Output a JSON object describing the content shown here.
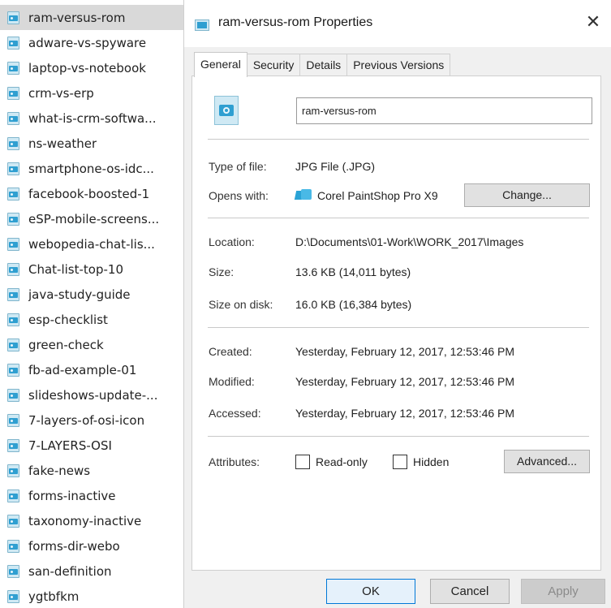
{
  "file_list": {
    "items": [
      {
        "name": "ram-versus-rom",
        "selected": true
      },
      {
        "name": "adware-vs-spyware"
      },
      {
        "name": "laptop-vs-notebook"
      },
      {
        "name": "crm-vs-erp"
      },
      {
        "name": "what-is-crm-softwa..."
      },
      {
        "name": "ns-weather"
      },
      {
        "name": "smartphone-os-idc..."
      },
      {
        "name": "facebook-boosted-1"
      },
      {
        "name": "eSP-mobile-screens..."
      },
      {
        "name": "webopedia-chat-lis..."
      },
      {
        "name": "Chat-list-top-10"
      },
      {
        "name": "java-study-guide"
      },
      {
        "name": "esp-checklist"
      },
      {
        "name": "green-check"
      },
      {
        "name": "fb-ad-example-01"
      },
      {
        "name": "slideshows-update-..."
      },
      {
        "name": "7-layers-of-osi-icon"
      },
      {
        "name": "7-LAYERS-OSI"
      },
      {
        "name": "fake-news"
      },
      {
        "name": "forms-inactive"
      },
      {
        "name": "taxonomy-inactive"
      },
      {
        "name": "forms-dir-webo"
      },
      {
        "name": "san-definition"
      },
      {
        "name": "ygtbfkm"
      }
    ],
    "icon": "jpg-image-icon"
  },
  "dialog": {
    "title": "ram-versus-rom Properties",
    "close_glyph": "✕",
    "tabs": [
      {
        "label": "General",
        "active": true
      },
      {
        "label": "Security"
      },
      {
        "label": "Details"
      },
      {
        "label": "Previous Versions"
      }
    ],
    "general": {
      "file_name": "ram-versus-rom",
      "type_label": "Type of file:",
      "type_value": "JPG File (.JPG)",
      "opens_label": "Opens with:",
      "opens_value": "Corel PaintShop Pro X9",
      "change_button": "Change...",
      "location_label": "Location:",
      "location_value": "D:\\Documents\\01-Work\\WORK_2017\\Images",
      "size_label": "Size:",
      "size_value": "13.6 KB (14,011 bytes)",
      "disk_label": "Size on disk:",
      "disk_value": "16.0 KB (16,384 bytes)",
      "created_label": "Created:",
      "created_value": "Yesterday, February 12, 2017, 12:53:46 PM",
      "modified_label": "Modified:",
      "modified_value": "Yesterday, February 12, 2017, 12:53:46 PM",
      "accessed_label": "Accessed:",
      "accessed_value": "Yesterday, February 12, 2017, 12:53:46 PM",
      "attributes_label": "Attributes:",
      "readonly_label": "Read-only",
      "readonly_checked": false,
      "hidden_label": "Hidden",
      "hidden_checked": false,
      "advanced_button": "Advanced..."
    },
    "footer": {
      "ok": "OK",
      "cancel": "Cancel",
      "apply": "Apply",
      "apply_enabled": false
    },
    "colors": {
      "accent": "#0078d7",
      "image_icon": "#2f9fd1",
      "selection": "#d9d9d9",
      "dialog_bg": "#f0f0f0"
    }
  }
}
